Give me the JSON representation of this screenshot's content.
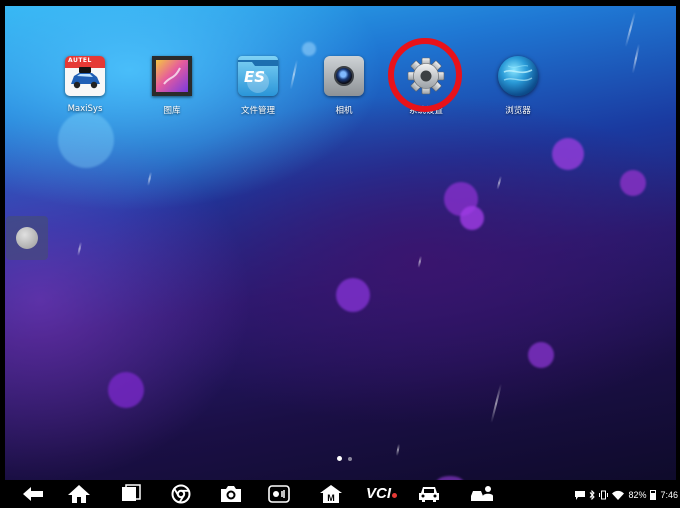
{
  "apps": [
    {
      "id": "maxisys",
      "label": "MaxiSys",
      "brand": "AUTEL",
      "icon": "maxisys-car-icon"
    },
    {
      "id": "gallery",
      "label": "图库",
      "icon": "gallery-icon"
    },
    {
      "id": "file-manager",
      "label": "文件管理",
      "badge": "ES",
      "icon": "file-manager-folder-icon"
    },
    {
      "id": "camera",
      "label": "相机",
      "icon": "camera-icon"
    },
    {
      "id": "settings",
      "label": "系统设置",
      "icon": "gear-icon"
    },
    {
      "id": "browser",
      "label": "浏览器",
      "icon": "globe-icon"
    }
  ],
  "highlight_color": "#e8121a",
  "nav_bar": {
    "buttons": [
      "back-icon",
      "home-icon",
      "recent-apps-icon",
      "chrome-icon",
      "camera-icon",
      "brightness-icon",
      "maxisys-home-icon",
      "vci-icon",
      "car-icon",
      "remote-desk-icon"
    ],
    "vci_label": "VCI"
  },
  "status_bar": {
    "battery": "82%",
    "time": "7:46",
    "icons": [
      "chat-icon",
      "bluetooth-icon",
      "vibrate-icon",
      "wifi-icon",
      "battery-icon"
    ]
  }
}
